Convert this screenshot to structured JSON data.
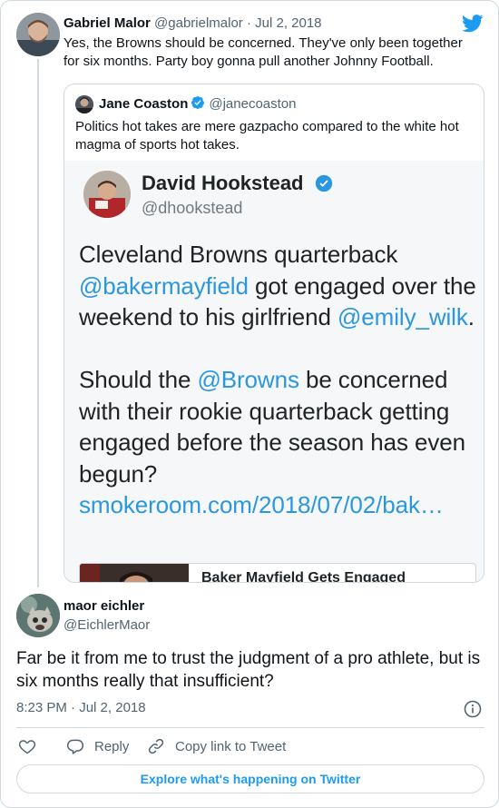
{
  "parent_tweet": {
    "name": "Gabriel Malor",
    "handle": "@gabrielmalor",
    "separator": "·",
    "date": "Jul 2, 2018",
    "text": "Yes, the Browns should be concerned. They've only been together for six months. Party boy gonna pull another Johnny Football."
  },
  "quoted_tweet": {
    "name": "Jane Coaston",
    "handle": "@janecoaston",
    "text": "Politics hot takes are mere gazpacho compared to the white hot magma of sports hot takes.",
    "image": {
      "name": "David Hookstead",
      "handle": "@dhookstead",
      "text_1": "Cleveland Browns quarterback ",
      "link_1": "@bakermayfield",
      "text_2": " got engaged over the weekend to his girlfriend ",
      "link_2": "@emily_wilk",
      "text_3": ".",
      "text_4": "Should the ",
      "link_3": "@Browns",
      "text_5": " be concerned with their rookie quarterback getting engaged before the season has even begun?",
      "link_4": "smokeroom.com/2018/07/02/bak…",
      "card_title": "Baker Mayfield Gets Engaged"
    }
  },
  "main_tweet": {
    "name": "maor eichler",
    "handle": "@EichlerMaor",
    "text": "Far be it from me to trust the judgment of a pro athlete, but is six months really that insufficient?",
    "time": "8:23 PM",
    "separator": "·",
    "date": "Jul 2, 2018"
  },
  "actions": {
    "like_icon": "heart-icon",
    "reply_label": "Reply",
    "copy_label": "Copy link to Tweet"
  },
  "explore_label": "Explore what's happening on Twitter",
  "colors": {
    "accent": "#1d9bf0",
    "secondary_text": "#536471",
    "border": "#cfd9de",
    "link_in_image": "#2b97df"
  }
}
